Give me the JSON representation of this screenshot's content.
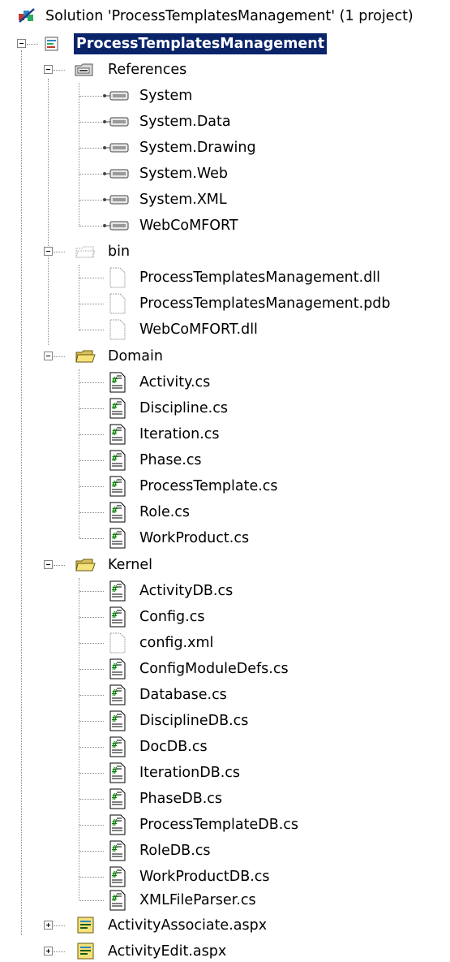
{
  "solution": {
    "label": "Solution 'ProcessTemplatesManagement' (1 project)",
    "icon": "solution-icon"
  },
  "project": {
    "label": "ProcessTemplatesManagement",
    "icon": "project-icon",
    "selected": true
  },
  "references": {
    "label": "References",
    "icon": "references-folder-icon",
    "items": [
      "System",
      "System.Data",
      "System.Drawing",
      "System.Web",
      "System.XML",
      "WebCoMFORT"
    ]
  },
  "bin": {
    "label": "bin",
    "icon": "hidden-folder-icon",
    "items": [
      "ProcessTemplatesManagement.dll",
      "ProcessTemplatesManagement.pdb",
      "WebCoMFORT.dll"
    ]
  },
  "domain": {
    "label": "Domain",
    "icon": "folder-icon",
    "items": [
      "Activity.cs",
      "Discipline.cs",
      "Iteration.cs",
      "Phase.cs",
      "ProcessTemplate.cs",
      "Role.cs",
      "WorkProduct.cs"
    ]
  },
  "kernel": {
    "label": "Kernel",
    "icon": "folder-icon",
    "items": [
      "ActivityDB.cs",
      "Config.cs",
      "config.xml",
      "ConfigModuleDefs.cs",
      "Database.cs",
      "DisciplineDB.cs",
      "DocDB.cs",
      "IterationDB.cs",
      "PhaseDB.cs",
      "ProcessTemplateDB.cs",
      "RoleDB.cs",
      "WorkProductDB.cs",
      "XMLFileParser.cs"
    ]
  },
  "pages": {
    "items": [
      "ActivityAssociate.aspx",
      "ActivityEdit.aspx"
    ]
  },
  "colors": {
    "selection_bg": "#0a246a",
    "selection_text": "#ffffff",
    "cs_icon_green": "#008000",
    "folder_yellow": "#f6e27a"
  }
}
